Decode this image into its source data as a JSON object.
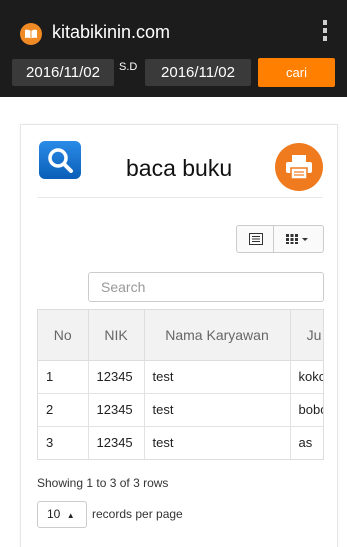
{
  "app": {
    "title": "kitabikinin.com"
  },
  "filter": {
    "date_from": "2016/11/02",
    "separator": "S.D",
    "date_to": "2016/11/02",
    "submit_label": "cari"
  },
  "card": {
    "title": "baca buku",
    "search_placeholder": "Search"
  },
  "table": {
    "columns": [
      "No",
      "NIK",
      "Nama Karyawan",
      "Ju"
    ],
    "rows": [
      [
        "1",
        "12345",
        "test",
        "koko"
      ],
      [
        "2",
        "12345",
        "test",
        "bobo"
      ],
      [
        "3",
        "12345",
        "test",
        "as"
      ]
    ]
  },
  "pagination": {
    "showing_text": "Showing 1 to 3 of 3 rows",
    "page_size": "10",
    "page_size_label": "records per page"
  },
  "colors": {
    "appbar": "#1c1c1c",
    "accent": "#ff7f00",
    "search_logo": "#1a73d0"
  },
  "icons": {
    "app_logo": "book-icon",
    "menu": "kebab-menu-icon",
    "card_logo": "magnifier-icon",
    "print": "printer-icon",
    "list_toggle": "list-view-icon",
    "columns": "columns-grid-icon"
  }
}
